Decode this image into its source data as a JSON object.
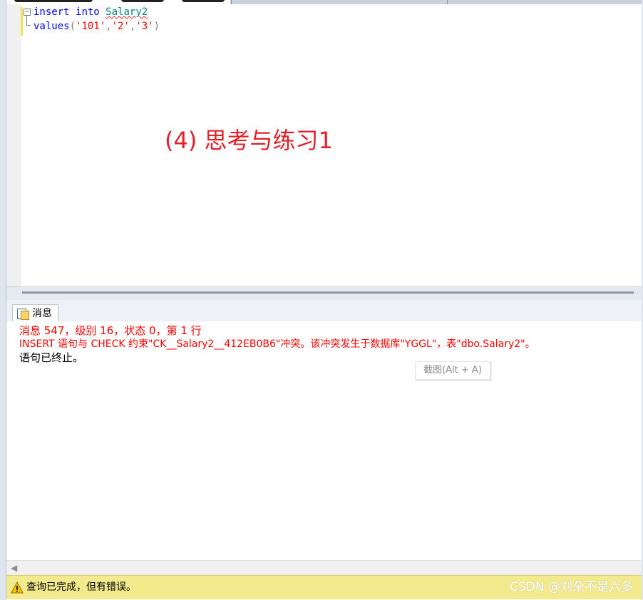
{
  "editor": {
    "lines": [
      {
        "keyword1": "insert",
        "keyword2": "into",
        "object": "Salary2"
      },
      {
        "keyword": "values",
        "open": "(",
        "v1": "'101'",
        "comma1": ",",
        "v2": "'2'",
        "comma2": ",",
        "v3": "'3'",
        "close": ")"
      }
    ],
    "fold_symbol": "−"
  },
  "annotation": "(4) 思考与练习1",
  "results": {
    "tab_label": "消息",
    "messages": [
      {
        "text": "消息 547，级别 16，状态 0，第 1 行",
        "color": "#ff0000"
      },
      {
        "text": "INSERT 语句与 CHECK 约束\"CK__Salary2__412EB0B6\"冲突。该冲突发生于数据库\"YGGL\"，表\"dbo.Salary2\"。",
        "color": "#ff0000"
      },
      {
        "text": "语句已终止。",
        "color": "#000000"
      }
    ],
    "tooltip": "截图(Alt + A)"
  },
  "scrollbar": {
    "left_arrow": "◀"
  },
  "statusbar": {
    "text": "查询已完成，但有错误。",
    "watermark": "CSDN @刘朵不是六多",
    "icon": "warning-icon"
  },
  "colors": {
    "keyword": "#0000ff",
    "object": "#008080",
    "string": "#ff0000",
    "error": "#ff0000",
    "status_bg": "#f3ea8e",
    "annotation": "#e3202a"
  }
}
